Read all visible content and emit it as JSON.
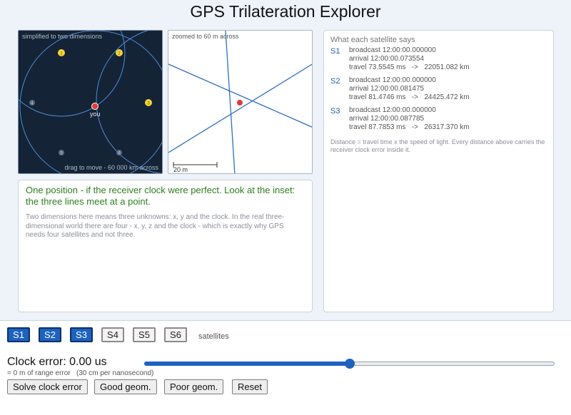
{
  "title": "GPS Trilateration Explorer",
  "map": {
    "title": "simplified to two dimensions",
    "footer": "drag to move  -  60 000 km across",
    "receiver_label": "you",
    "satellites": [
      {
        "id": "1",
        "active": true
      },
      {
        "id": "2",
        "active": true
      },
      {
        "id": "3",
        "active": true
      },
      {
        "id": "4",
        "active": false
      },
      {
        "id": "5",
        "active": false
      },
      {
        "id": "6",
        "active": false
      }
    ]
  },
  "inset": {
    "title": "zoomed to 60 m across",
    "scale_label": "20 m"
  },
  "explanation": {
    "headline": "One position - if the receiver clock were perfect. Look at the inset: the three lines meet at a point.",
    "body": "Two dimensions here means three unknowns: x, y and the clock. In the real three-dimensional world there are four - x, y, z and the clock - which is exactly why GPS needs four satellites and not three."
  },
  "satellite_says": {
    "title": "What each satellite says",
    "entries": [
      {
        "id": "S1",
        "broadcast": "broadcast 12:00:00.000000",
        "arrival": "arrival 12:00:00.073554",
        "travel": "travel 73.5545 ms   ->   22051.082 km"
      },
      {
        "id": "S2",
        "broadcast": "broadcast 12:00:00.000000",
        "arrival": "arrival 12:00:00.081475",
        "travel": "travel 81.4746 ms   ->   24425.472 km"
      },
      {
        "id": "S3",
        "broadcast": "broadcast 12:00:00.000000",
        "arrival": "arrival 12:00:00.087785",
        "travel": "travel 87.7853 ms   ->   26317.370 km"
      }
    ],
    "note": "Distance = travel time x the speed of light. Every distance above carries the receiver clock error inside it."
  },
  "controls": {
    "sat_buttons": [
      {
        "label": "S1",
        "active": true
      },
      {
        "label": "S2",
        "active": true
      },
      {
        "label": "S3",
        "active": true
      },
      {
        "label": "S4",
        "active": false
      },
      {
        "label": "S5",
        "active": false
      },
      {
        "label": "S6",
        "active": false
      }
    ],
    "sat_label": "satellites",
    "clock_error": "Clock error: 0.00 us",
    "clock_sub": "= 0 m of range error   (30 cm per nanosecond)",
    "slider_fraction": 0.5,
    "buttons": {
      "solve": "Solve clock error",
      "good": "Good geom.",
      "poor": "Poor geom.",
      "reset": "Reset"
    }
  },
  "colors": {
    "accent": "#1e62c0",
    "satellite_active": "#f5d33b",
    "receiver": "#e53935",
    "map_background": "#142436",
    "headline": "#2e7d1f"
  }
}
